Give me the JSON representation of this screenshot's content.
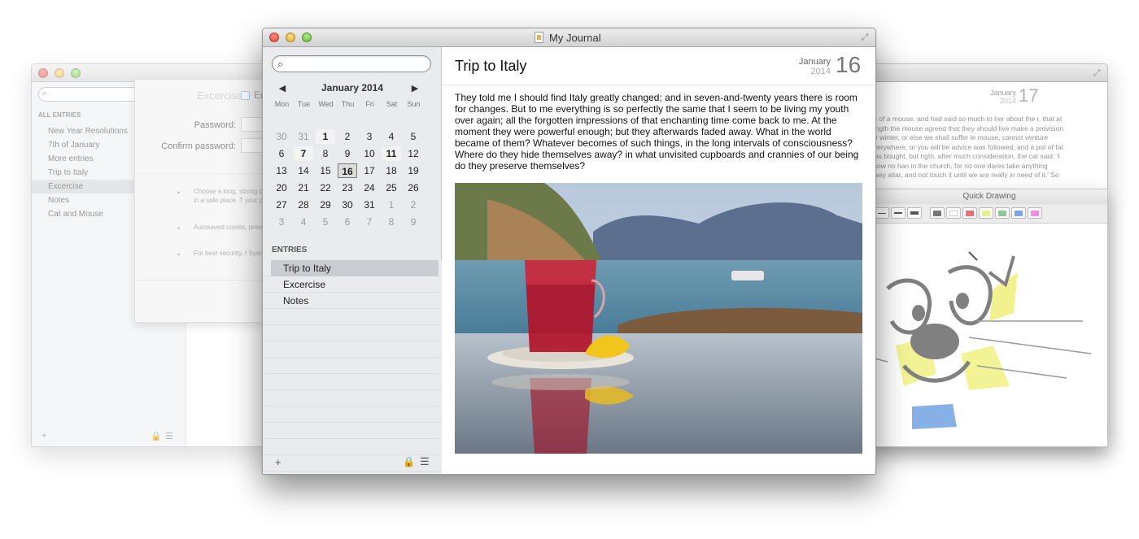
{
  "main_window": {
    "title": "My Journal",
    "calendar": {
      "month_label": "January 2014",
      "prev_glyph": "◀",
      "next_glyph": "▶",
      "weekdays": [
        "Mon",
        "Tue",
        "Wed",
        "Thu",
        "Fri",
        "Sat",
        "Sun"
      ],
      "weeks": [
        [
          "30",
          "31",
          "1",
          "2",
          "3",
          "4",
          "5"
        ],
        [
          "6",
          "7",
          "8",
          "9",
          "10",
          "11",
          "12"
        ],
        [
          "13",
          "14",
          "15",
          "16",
          "17",
          "18",
          "19"
        ],
        [
          "20",
          "21",
          "22",
          "23",
          "24",
          "25",
          "26"
        ],
        [
          "27",
          "28",
          "29",
          "30",
          "31",
          "1",
          "2"
        ],
        [
          "3",
          "4",
          "5",
          "6",
          "7",
          "8",
          "9"
        ]
      ]
    },
    "entries_heading": "ENTRIES",
    "entries": [
      "Trip to Italy",
      "Excercise",
      "Notes"
    ],
    "bottom_bar": {
      "add_glyph": "+",
      "lock_glyph": "🔒",
      "list_glyph": "☰"
    },
    "entry": {
      "title": "Trip to Italy",
      "month": "January",
      "year": "2014",
      "day": "16",
      "body": "They told me I should find Italy greatly changed; and in seven-and-twenty years there is room for changes.  But to me everything is so perfectly the same that I seem to be living my youth over again; all the forgotten impressions of that enchanting time come back to me.  At the moment they were powerful enough; but they afterwards faded away.  What in the world became of them?  Whatever becomes of such things, in the long intervals of consciousness? Where do they hide themselves away? in what unvisited cupboards and crannies of our being do they preserve themselves?"
    }
  },
  "left_window": {
    "heading": "ALL ENTRIES",
    "entries": [
      "New Year Resolutions",
      "7th of January",
      "More entries",
      "Trip to Italy",
      "Excercise",
      "Notes",
      "Cat and Mouse"
    ],
    "password_sheet": {
      "ghost_title": "Excercise",
      "checkbox_label": "En",
      "password_label": "Password:",
      "confirm_label": "Confirm password:",
      "tips": [
        "Choose a long, strong password and keep it in a safe place. T your password, you",
        "Autosaved copies, previously unencry",
        "For best security, t System Preferences"
      ],
      "bullet": "•"
    },
    "bottom_bar": {
      "add_glyph": "+",
      "lock_glyph": "🔒",
      "list_glyph": "☰"
    }
  },
  "right_window": {
    "month": "January",
    "year": "2014",
    "day": "17",
    "text": "ce of a mouse, and had said so much to her about the r, that at length the mouse agreed that they should live make a provision for winter, or else we shall suffer le mouse, cannot venture everywhere, or you will be advice was followed, and a pot of fat was bought, but ngth, after much consideration, the cat said: 'I know no han in the church, for no one dares take anything away altar, and not touch it until we are really in need of it.' So",
    "quick_drawing": {
      "title": "Quick Drawing"
    }
  },
  "colors": {
    "selection": "#c9ccd1",
    "sidebar_bg": "#e9ebee",
    "drawing_palette": [
      "#777777",
      "#ffffff",
      "#e8727a",
      "#e6ef8e",
      "#8dcb94",
      "#7aa7e3",
      "#ef8ee8"
    ]
  }
}
